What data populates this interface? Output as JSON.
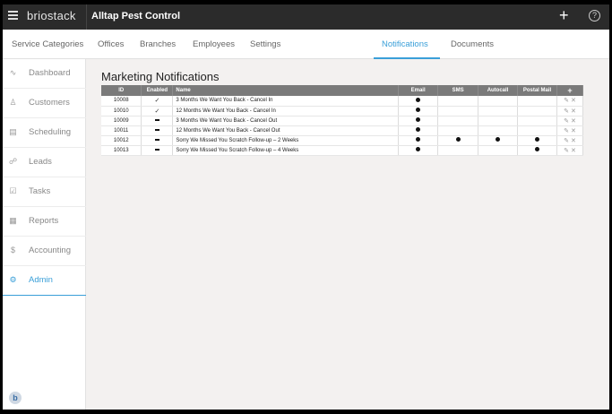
{
  "app": {
    "brand": "briostack",
    "company": "Alltap Pest Control",
    "plus": "+",
    "help": "?"
  },
  "tabs": [
    {
      "label": "Service Categories",
      "active": false
    },
    {
      "label": "Offices",
      "active": false
    },
    {
      "label": "Branches",
      "active": false
    },
    {
      "label": "Employees",
      "active": false
    },
    {
      "label": "Settings",
      "active": false
    },
    {
      "label": "Notifications",
      "active": true
    },
    {
      "label": "Documents",
      "active": false
    }
  ],
  "sidebar": {
    "items": [
      {
        "label": "Dashboard",
        "icon": "dashboard-icon",
        "glyph": "∿"
      },
      {
        "label": "Customers",
        "icon": "person-icon",
        "glyph": "♙"
      },
      {
        "label": "Scheduling",
        "icon": "calendar-icon",
        "glyph": "▤"
      },
      {
        "label": "Leads",
        "icon": "people-icon",
        "glyph": "☍"
      },
      {
        "label": "Tasks",
        "icon": "checkbox-icon",
        "glyph": "☑"
      },
      {
        "label": "Reports",
        "icon": "report-icon",
        "glyph": "▦"
      },
      {
        "label": "Accounting",
        "icon": "dollar-icon",
        "glyph": "$"
      },
      {
        "label": "Admin",
        "icon": "gear-icon",
        "glyph": "⚙",
        "active": true
      }
    ],
    "avatar": "b"
  },
  "main": {
    "title": "Marketing Notifications",
    "columns": {
      "id": "ID",
      "enabled": "Enabled",
      "name": "Name",
      "email": "Email",
      "sms": "SMS",
      "autocall": "Autocall",
      "postal": "Postal Mail",
      "add": "+"
    },
    "rows": [
      {
        "id": "10008",
        "enabled": "check",
        "name": "3 Months We Want You Back - Cancel In",
        "email": true,
        "sms": false,
        "autocall": false,
        "postal": false
      },
      {
        "id": "10010",
        "enabled": "check",
        "name": "12 Months We Want You Back - Cancel In",
        "email": true,
        "sms": false,
        "autocall": false,
        "postal": false
      },
      {
        "id": "10009",
        "enabled": "dash",
        "name": "3 Months We Want You Back - Cancel Out",
        "email": true,
        "sms": false,
        "autocall": false,
        "postal": false
      },
      {
        "id": "10011",
        "enabled": "dash",
        "name": "12 Months We Want You Back - Cancel Out",
        "email": true,
        "sms": false,
        "autocall": false,
        "postal": false
      },
      {
        "id": "10012",
        "enabled": "dash",
        "name": "Sorry We Missed You Scratch Follow-up – 2 Weeks",
        "email": true,
        "sms": true,
        "autocall": true,
        "postal": true
      },
      {
        "id": "10013",
        "enabled": "dash",
        "name": "Sorry We Missed You Scratch Follow-up – 4 Weeks",
        "email": true,
        "sms": false,
        "autocall": false,
        "postal": true
      }
    ]
  },
  "colors": {
    "accent": "#3a9fd8",
    "topbar": "#2b2b2b",
    "table_header": "#7a7a7a"
  }
}
